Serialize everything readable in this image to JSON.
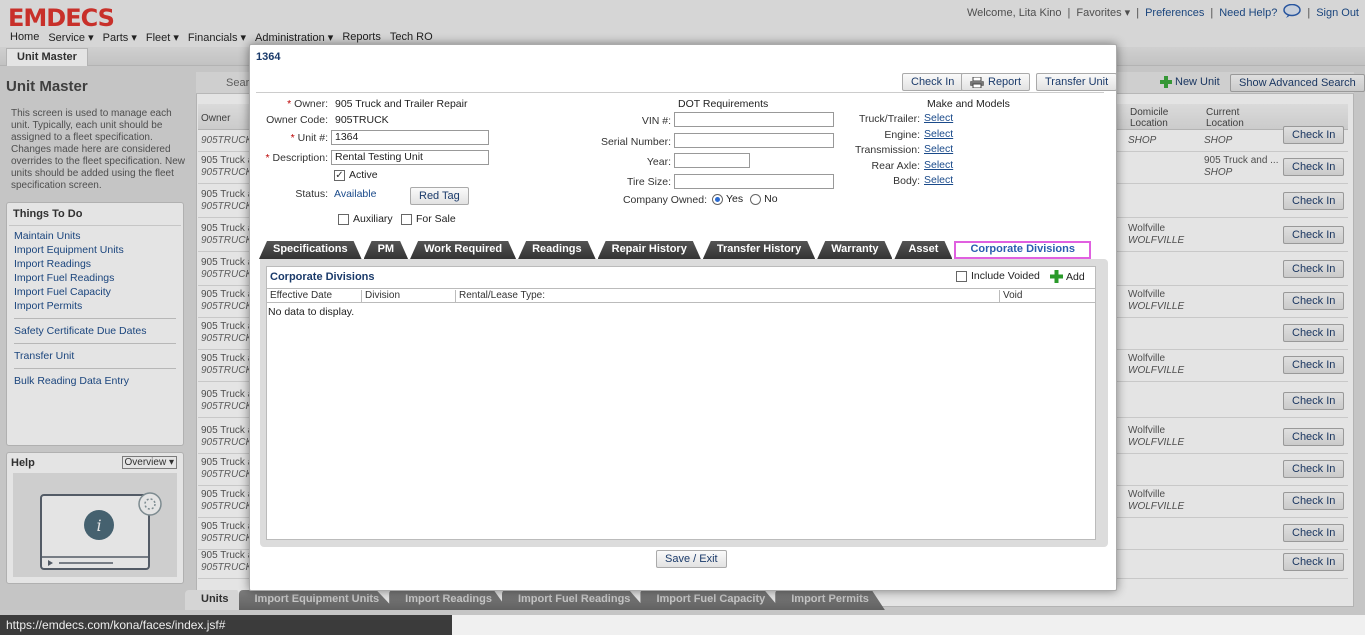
{
  "header": {
    "logo": "EMDECS",
    "welcome": "Welcome, Lita Kino",
    "favorites": "Favorites ▾",
    "preferences": "Preferences",
    "need_help": "Need Help?",
    "sign_out": "Sign Out"
  },
  "nav": {
    "items": [
      {
        "label": "Home"
      },
      {
        "label": "Service ▾"
      },
      {
        "label": "Parts ▾"
      },
      {
        "label": "Fleet ▾"
      },
      {
        "label": "Financials ▾"
      },
      {
        "label": "Administration ▾"
      },
      {
        "label": "Reports"
      },
      {
        "label": "Tech RO"
      }
    ],
    "active_tab": "Unit Master"
  },
  "left": {
    "title": "Unit Master",
    "description": "This screen is used to manage each unit. Typically, each unit should be assigned to a fleet specification. Changes made here are considered overrides to the fleet specification. New units should be added using the fleet specification screen.",
    "todo_title": "Things To Do",
    "todo_group1": [
      "Maintain Units",
      "Import Equipment Units",
      "Import Readings",
      "Import Fuel Readings",
      "Import Fuel Capacity",
      "Import Permits"
    ],
    "todo_group2": [
      "Safety Certificate Due Dates"
    ],
    "todo_group3": [
      "Transfer Unit"
    ],
    "todo_group4": [
      "Bulk Reading Data Entry"
    ],
    "help_title": "Help",
    "help_select": "Overview"
  },
  "grid": {
    "search_label": "Searc",
    "new_unit": "New Unit",
    "advanced_search": "Show Advanced Search",
    "col_owner": "Owner",
    "col_domicile": "Domicile Location",
    "col_current": "Current Location",
    "check_in_label": "Check In",
    "rows": [
      {
        "o1": "",
        "o2": "905TRUCK",
        "dm1": "",
        "dm2": "SHOP",
        "cl1": "",
        "cl2": "SHOP"
      },
      {
        "o1": "905 Truck a",
        "o2": "905TRUCK",
        "dm1": "",
        "dm2": "",
        "cl1": "905 Truck and ...",
        "cl2": "SHOP"
      },
      {
        "o1": "905 Truck a",
        "o2": "905TRUCK",
        "dm1": "",
        "dm2": "",
        "cl1": "",
        "cl2": ""
      },
      {
        "o1": "905 Truck a",
        "o2": "905TRUCK",
        "dm1": "Wolfville",
        "dm2": "WOLFVILLE",
        "cl1": "",
        "cl2": ""
      },
      {
        "o1": "905 Truck a",
        "o2": "905TRUCK",
        "dm1": "",
        "dm2": "",
        "cl1": "",
        "cl2": ""
      },
      {
        "o1": "905 Truck a",
        "o2": "905TRUCK",
        "dm1": "Wolfville",
        "dm2": "WOLFVILLE",
        "cl1": "",
        "cl2": ""
      },
      {
        "o1": "905 Truck a",
        "o2": "905TRUCK",
        "dm1": "",
        "dm2": "",
        "cl1": "",
        "cl2": ""
      },
      {
        "o1": "905 Truck a",
        "o2": "905TRUCK",
        "dm1": "Wolfville",
        "dm2": "WOLFVILLE",
        "cl1": "",
        "cl2": ""
      },
      {
        "o1": "905 Truck a",
        "o2": "905TRUCK",
        "dm1": "",
        "dm2": "",
        "cl1": "",
        "cl2": ""
      },
      {
        "o1": "905 Truck a",
        "o2": "905TRUCK",
        "dm1": "Wolfville",
        "dm2": "WOLFVILLE",
        "cl1": "",
        "cl2": ""
      },
      {
        "o1": "905 Truck a",
        "o2": "905TRUCK",
        "dm1": "",
        "dm2": "",
        "cl1": "",
        "cl2": ""
      },
      {
        "o1": "905 Truck a",
        "o2": "905TRUCK",
        "dm1": "Wolfville",
        "dm2": "WOLFVILLE",
        "cl1": "",
        "cl2": ""
      },
      {
        "o1": "905 Truck a",
        "o2": "905TRUCK",
        "dm1": "",
        "dm2": "",
        "cl1": "",
        "cl2": ""
      },
      {
        "o1": "905 Truck a",
        "o2": "905TRUCK",
        "dm1": "",
        "dm2": "",
        "cl1": "",
        "cl2": ""
      }
    ]
  },
  "bottom_tabs": [
    "Units",
    "Import Equipment Units",
    "Import Readings",
    "Import Fuel Readings",
    "Import Fuel Capacity",
    "Import Permits"
  ],
  "status_url": "https://emdecs.com/kona/faces/index.jsf#",
  "modal": {
    "title": "1364",
    "btn_check_in": "Check In",
    "btn_report": "Report",
    "btn_transfer": "Transfer Unit",
    "owner_label": "Owner:",
    "owner_value": "905 Truck and Trailer Repair",
    "owner_code_label": "Owner Code:",
    "owner_code_value": "905TRUCK",
    "unit_label": "Unit #:",
    "unit_value": "1364",
    "desc_label": "Description:",
    "desc_value": "Rental Testing Unit",
    "active_label": "Active",
    "status_label": "Status:",
    "status_value": "Available",
    "red_tag": "Red Tag",
    "auxiliary": "Auxiliary",
    "for_sale": "For Sale",
    "dot_title": "DOT Requirements",
    "vin_label": "VIN #:",
    "serial_label": "Serial Number:",
    "year_label": "Year:",
    "tire_label": "Tire Size:",
    "company_owned_label": "Company Owned:",
    "yes": "Yes",
    "no": "No",
    "mm_title": "Make and Models",
    "mm_rows": [
      {
        "label": "Truck/Trailer:",
        "link": "Select"
      },
      {
        "label": "Engine:",
        "link": "Select"
      },
      {
        "label": "Transmission:",
        "link": "Select"
      },
      {
        "label": "Rear Axle:",
        "link": "Select"
      },
      {
        "label": "Body:",
        "link": "Select"
      }
    ],
    "tabs": [
      "Specifications",
      "PM",
      "Work Required",
      "Readings",
      "Repair History",
      "Transfer History",
      "Warranty",
      "Asset",
      "Corporate Divisions"
    ],
    "cd_title": "Corporate Divisions",
    "include_voided": "Include Voided",
    "add": "Add",
    "cols": [
      "Effective Date",
      "Division",
      "Rental/Lease Type:",
      "Void"
    ],
    "empty": "No data to display.",
    "save_exit": "Save / Exit"
  },
  "colors": {
    "brand": "#e0332c",
    "link": "#1a4a8a",
    "tab_highlight": "#e060e0",
    "add_green": "#2a9a2a"
  }
}
